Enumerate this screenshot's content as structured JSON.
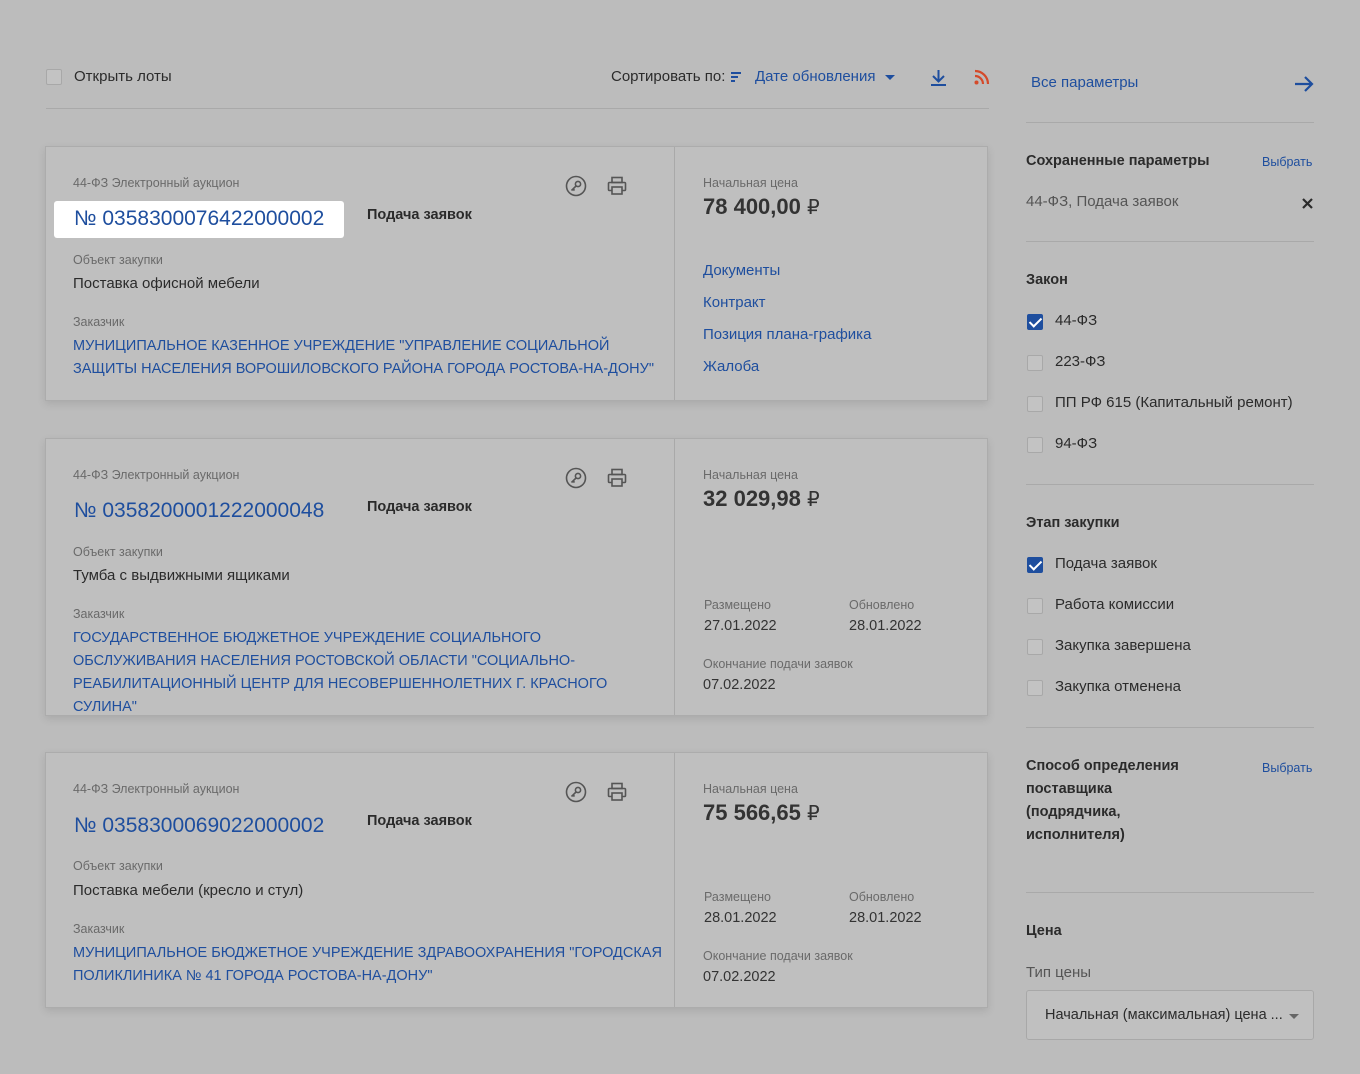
{
  "toolbar": {
    "open_lots": "Открыть лоты",
    "sort_label": "Сортировать по:",
    "sort_value": "Дате обновления"
  },
  "lots": [
    {
      "law": "44-ФЗ Электронный аукцион",
      "number": "№ 0358300076422000002",
      "stage": "Подача заявок",
      "object_label": "Объект закупки",
      "object": "Поставка офисной мебели",
      "customer_label": "Заказчик",
      "customer": "МУНИЦИПАЛЬНОЕ КАЗЕННОЕ УЧРЕЖДЕНИЕ \"УПРАВЛЕНИЕ СОЦИАЛЬНОЙ ЗАЩИТЫ НАСЕЛЕНИЯ ВОРОШИЛОВСКОГО РАЙОНА ГОРОДА РОСТОВА-НА-ДОНУ\"",
      "price_label": "Начальная цена",
      "price": "78 400,00",
      "links": [
        "Документы",
        "Контракт",
        "Позиция плана-графика",
        "Жалоба"
      ]
    },
    {
      "law": "44-ФЗ Электронный аукцион",
      "number": "№ 0358200001222000048",
      "stage": "Подача заявок",
      "object_label": "Объект закупки",
      "object": "Тумба с выдвижными ящиками",
      "customer_label": "Заказчик",
      "customer": "ГОСУДАРСТВЕННОЕ БЮДЖЕТНОЕ УЧРЕЖДЕНИЕ СОЦИАЛЬНОГО ОБСЛУЖИВАНИЯ НАСЕЛЕНИЯ РОСТОВСКОЙ ОБЛАСТИ \"СОЦИАЛЬНО-РЕАБИЛИТАЦИОННЫЙ ЦЕНТР ДЛЯ НЕСОВЕРШЕННОЛЕТНИХ Г. КРАСНОГО СУЛИНА\"",
      "price_label": "Начальная цена",
      "price": "32 029,98",
      "posted_label": "Размещено",
      "posted": "27.01.2022",
      "updated_label": "Обновлено",
      "updated": "28.01.2022",
      "deadline_label": "Окончание подачи заявок",
      "deadline": "07.02.2022"
    },
    {
      "law": "44-ФЗ Электронный аукцион",
      "number": "№ 0358300069022000002",
      "stage": "Подача заявок",
      "object_label": "Объект закупки",
      "object": "Поставка мебели (кресло и стул)",
      "customer_label": "Заказчик",
      "customer": "МУНИЦИПАЛЬНОЕ БЮДЖЕТНОЕ УЧРЕЖДЕНИЕ ЗДРАВООХРАНЕНИЯ \"ГОРОДСКАЯ ПОЛИКЛИНИКА № 41 ГОРОДА РОСТОВА-НА-ДОНУ\"",
      "price_label": "Начальная цена",
      "price": "75 566,65",
      "posted_label": "Размещено",
      "posted": "28.01.2022",
      "updated_label": "Обновлено",
      "updated": "28.01.2022",
      "deadline_label": "Окончание подачи заявок",
      "deadline": "07.02.2022"
    }
  ],
  "currency": "₽",
  "sidebar": {
    "all_params": "Все параметры",
    "saved_title": "Сохраненные параметры",
    "choose": "Выбрать",
    "saved_value": "44-ФЗ, Подача заявок",
    "law_title": "Закон",
    "laws": [
      {
        "label": "44-ФЗ",
        "checked": true
      },
      {
        "label": "223-ФЗ",
        "checked": false
      },
      {
        "label": "ПП РФ 615 (Капитальный ремонт)",
        "checked": false
      },
      {
        "label": "94-ФЗ",
        "checked": false
      }
    ],
    "stage_title": "Этап закупки",
    "stages": [
      {
        "label": "Подача заявок",
        "checked": true
      },
      {
        "label": "Работа комиссии",
        "checked": false
      },
      {
        "label": "Закупка завершена",
        "checked": false
      },
      {
        "label": "Закупка отменена",
        "checked": false
      }
    ],
    "method_title_1": "Способ определения",
    "method_title_2": "поставщика",
    "method_title_3": "(подрядчика,",
    "method_title_4": "исполнителя)",
    "price_title": "Цена",
    "price_type_label": "Тип цены",
    "price_type_value": "Начальная (максимальная) цена ..."
  },
  "colors": {
    "accent": "#1e4e9e",
    "rss": "#d44a2a"
  }
}
